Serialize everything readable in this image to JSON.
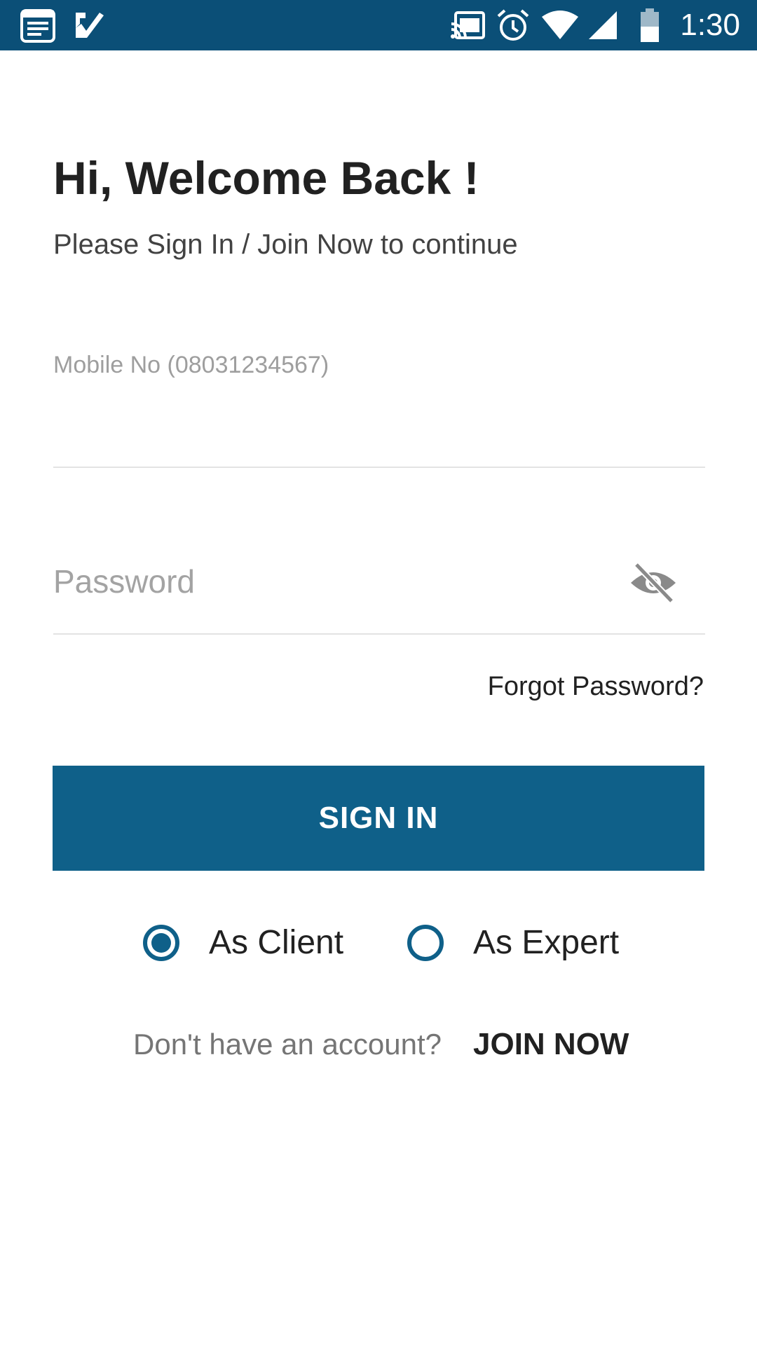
{
  "status_bar": {
    "time": "1:30",
    "left_icons": [
      "notes-icon",
      "checkmark-app-icon"
    ],
    "right_icons": [
      "cast-icon",
      "alarm-icon",
      "wifi-icon",
      "signal-icon",
      "battery-icon"
    ]
  },
  "header": {
    "title": "Hi, Welcome Back !",
    "subtitle": "Please Sign In / Join Now to continue"
  },
  "form": {
    "mobile_label": "Mobile No (08031234567)",
    "mobile_value": "",
    "password_placeholder": "Password",
    "password_value": "",
    "forgot_password": "Forgot Password?",
    "sign_in_label": "SIGN IN"
  },
  "role": {
    "options": [
      {
        "label": "As Client",
        "selected": true
      },
      {
        "label": "As Expert",
        "selected": false
      }
    ]
  },
  "footer": {
    "prompt": "Don't have an account?",
    "join_label": "JOIN NOW"
  },
  "colors": {
    "status_bar": "#0b4f77",
    "primary": "#0f6089"
  }
}
